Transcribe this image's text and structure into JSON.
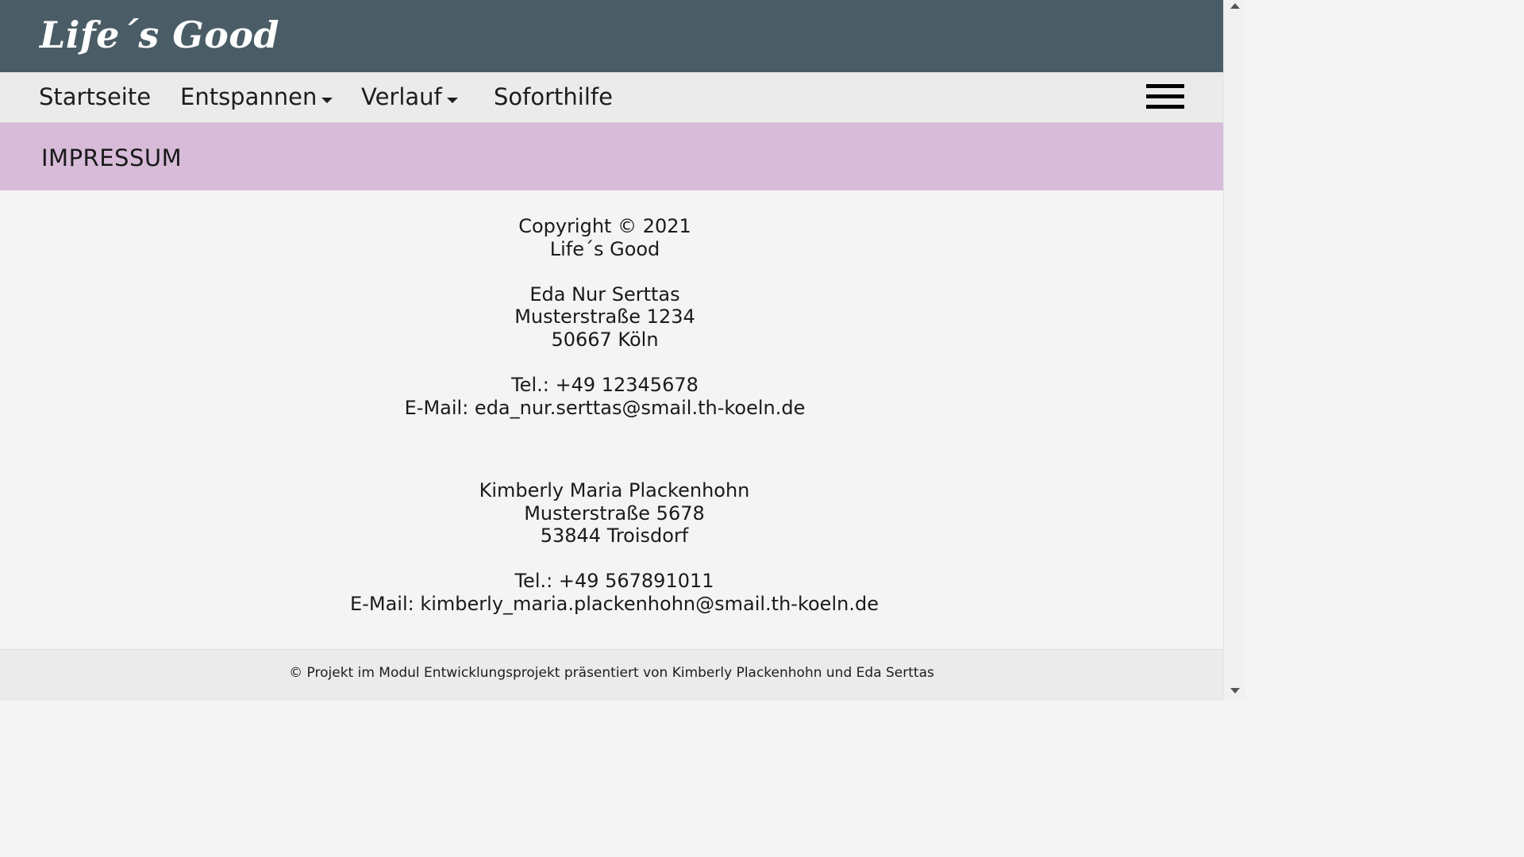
{
  "header": {
    "logo": "Life´s Good"
  },
  "nav": {
    "items": [
      {
        "label": "Startseite"
      },
      {
        "label": "Entspannen"
      },
      {
        "label": "Verlauf"
      },
      {
        "label": "Soforthilfe"
      }
    ],
    "menu_icon": "hamburger-menu-icon"
  },
  "page": {
    "title": "IMPRESSUM"
  },
  "impressum": {
    "copyright": "Copyright © 2021",
    "site_name": "Life´s Good",
    "person1": {
      "name": "Eda Nur Serttas",
      "street": "Musterstraße 1234",
      "city": "50667 Köln",
      "tel": "Tel.: +49 12345678",
      "email": "E-Mail: eda_nur.serttas@smail.th-koeln.de"
    },
    "person2": {
      "name": "Kimberly Maria Plackenhohn",
      "street": "Musterstraße 5678",
      "city": "53844 Troisdorf",
      "tel": "Tel.: +49 567891011",
      "email": "E-Mail: kimberly_maria.plackenhohn@smail.th-koeln.de"
    }
  },
  "footer": {
    "text": "© Projekt im Modul Entwicklungsprojekt präsentiert von Kimberly Plackenhohn und Eda Serttas"
  },
  "colors": {
    "header_bg": "#4a5d66",
    "nav_bg": "#ebebeb",
    "title_band_bg": "#d8bbd9",
    "content_bg": "#f4f4f4"
  }
}
